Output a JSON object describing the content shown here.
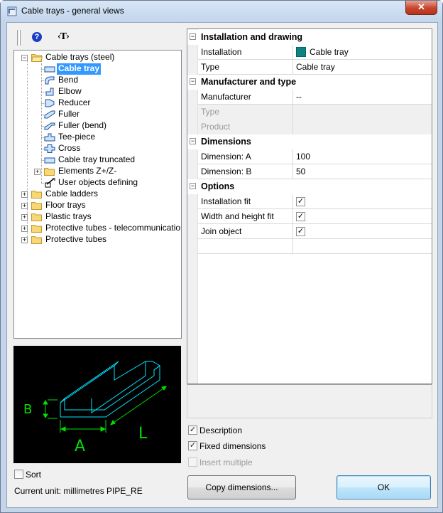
{
  "window": {
    "title": "Cable trays - general views",
    "close_glyph": "✕"
  },
  "toolbar": {
    "help_glyph": "?",
    "text_glyph": "‹T›"
  },
  "tree": {
    "root": "Cable trays (steel)",
    "children": [
      "Cable tray",
      "Bend",
      "Elbow",
      "Reducer",
      "Fuller",
      "Fuller (bend)",
      "Tee-piece",
      "Cross",
      "Cable tray truncated",
      "Elements Z+/Z-",
      "User objects defining"
    ],
    "others": [
      "Cable ladders",
      "Floor trays",
      "Plastic trays",
      "Protective tubes - telecommunications",
      "Protective tubes"
    ],
    "selected": "Cable tray",
    "expand_plus": "+",
    "expand_minus": "−"
  },
  "preview": {
    "label_a": "A",
    "label_b": "B",
    "label_l": "L",
    "line_color": "#00e5ff",
    "dim_color": "#00e000"
  },
  "sort": {
    "label": "Sort",
    "checked": false
  },
  "status": {
    "unit": "Current unit: millimetres  PIPE_RE"
  },
  "grid": {
    "collapse_glyph": "−",
    "sections": [
      {
        "title": "Installation and drawing",
        "rows": [
          {
            "name": "Installation",
            "value": "Cable tray"
          },
          {
            "name": "Type",
            "value": "Cable tray"
          }
        ]
      },
      {
        "title": "Manufacturer and type",
        "rows": [
          {
            "name": "Manufacturer",
            "value": "--"
          },
          {
            "name": "Type",
            "value": ""
          },
          {
            "name": "Product",
            "value": ""
          }
        ]
      },
      {
        "title": "Dimensions",
        "rows": [
          {
            "name": "Dimension: A",
            "value": "100"
          },
          {
            "name": "Dimension: B",
            "value": "50"
          }
        ]
      },
      {
        "title": "Options",
        "rows": [
          {
            "name": "Installation fit",
            "checked": true
          },
          {
            "name": "Width and height fit",
            "checked": true
          },
          {
            "name": "Join object",
            "checked": true
          }
        ]
      }
    ],
    "installation_color": "#0e8280",
    "check_glyph": "✓"
  },
  "options": {
    "description": {
      "label": "Description",
      "checked": true
    },
    "fixed_dimensions": {
      "label": "Fixed dimensions",
      "checked": true
    },
    "insert_multiple": {
      "label": "Insert multiple",
      "checked": false,
      "disabled": true
    }
  },
  "buttons": {
    "copy": "Copy dimensions...",
    "ok": "OK"
  }
}
